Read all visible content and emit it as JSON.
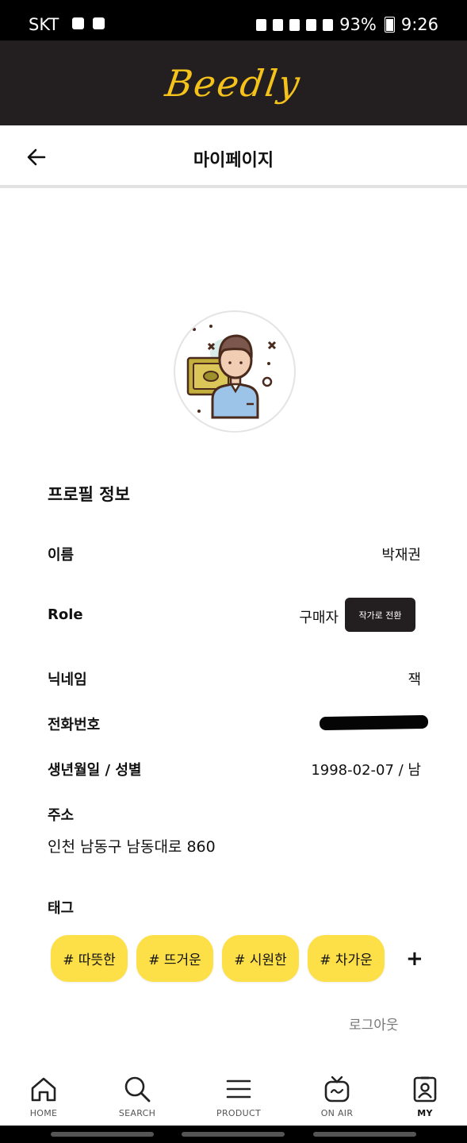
{
  "status_bar": {
    "carrier": "SKT",
    "battery": "93%",
    "time": "9:26"
  },
  "header": {
    "logo": "Beedly"
  },
  "title_bar": {
    "title": "마이페이지",
    "back_icon": "arrow-left-icon"
  },
  "avatar": {
    "icon": "user-with-money-illustration"
  },
  "profile": {
    "section_title": "프로필 정보",
    "name_label": "이름",
    "name_value": "박재권",
    "role_label": "Role",
    "role_value": "구매자",
    "role_switch_button": "작가로 전환",
    "nickname_label": "닉네임",
    "nickname_value": "잭",
    "phone_label": "전화번호",
    "birth_gender_label": "생년월일 / 성별",
    "birth_gender_value": "1998-02-07 / 남",
    "address_label": "주소",
    "address_value": "인천 남동구 남동대로 860"
  },
  "tags": {
    "label": "태그",
    "items": [
      "# 따뜻한",
      "# 뜨거운",
      "# 시원한",
      "# 차가운"
    ],
    "add": "+"
  },
  "logout_label": "로그아웃",
  "bottom_nav": {
    "items": [
      {
        "label": "HOME",
        "icon": "home-icon"
      },
      {
        "label": "SEARCH",
        "icon": "search-icon"
      },
      {
        "label": "PRODUCT",
        "icon": "menu-icon"
      },
      {
        "label": "ON AIR",
        "icon": "tv-icon"
      },
      {
        "label": "MY",
        "icon": "profile-card-icon"
      }
    ]
  },
  "colors": {
    "accent_yellow": "#fddf47",
    "logo_yellow": "#f4c21a",
    "header_dark": "#231f20"
  }
}
